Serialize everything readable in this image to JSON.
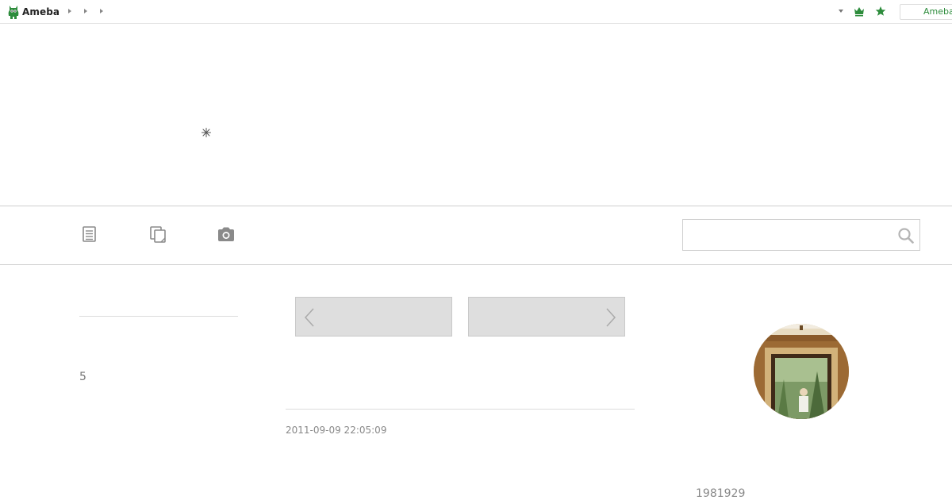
{
  "topbar": {
    "logo_text": "Ameba",
    "search_label": "Ameba"
  },
  "icons": {
    "logo": "ameba-logo-icon",
    "breadcrumb": "chevron-right-icon",
    "dropdown": "caret-down-icon",
    "crown": "crown-icon",
    "star": "star-icon",
    "loader": "loading-spinner-icon",
    "entries": "document-list-icon",
    "themes": "copy-pages-icon",
    "photos": "camera-icon",
    "search": "search-icon",
    "prev": "chevron-left-icon",
    "next": "chevron-right-icon"
  },
  "nav": {
    "search_placeholder": ""
  },
  "left": {
    "count": "5"
  },
  "entry": {
    "date": "2011-09-09 22:05:09"
  },
  "profile": {
    "id": "1981929"
  },
  "colors": {
    "brand_green": "#2d8c3c",
    "icon_gray": "#8a8a8a",
    "pager_bg": "#dedede",
    "divider": "#cfcfcf"
  }
}
